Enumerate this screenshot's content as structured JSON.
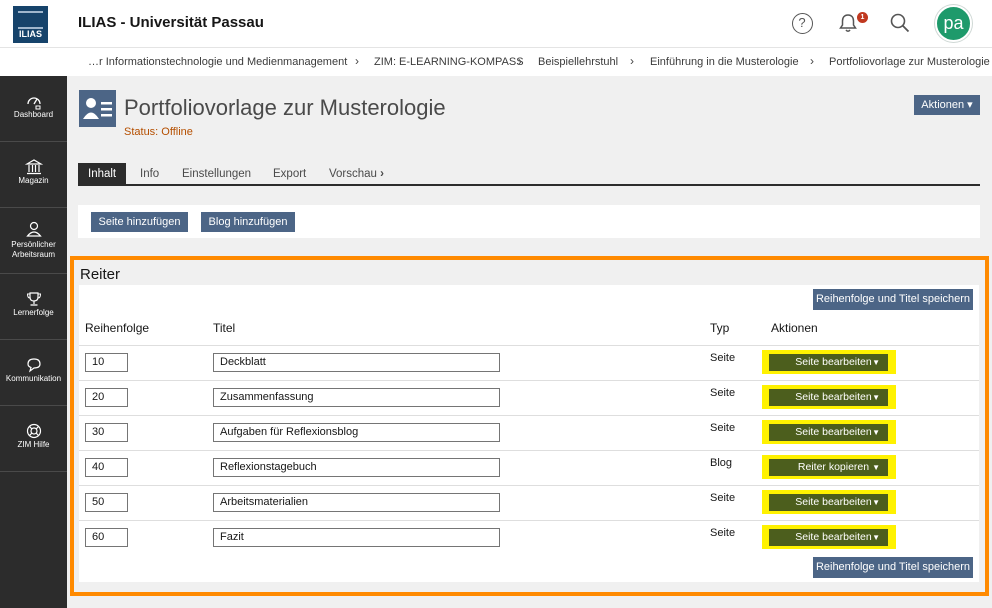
{
  "header": {
    "logo_text": "ILIAS",
    "site_title": "ILIAS - Universität Passau",
    "notification_count": "1",
    "avatar_initials": "pa"
  },
  "breadcrumb": [
    "…r Informationstechnologie und Medienmanagement",
    "ZIM: E-LEARNING-KOMPASS",
    "Beispiellehrstuhl",
    "Einführung in die Musterologie",
    "Portfoliovorlage zur Musterologie"
  ],
  "sidebar": {
    "items": [
      {
        "label": "Dashboard",
        "icon": "dashboard-icon"
      },
      {
        "label": "Magazin",
        "icon": "repository-icon"
      },
      {
        "label": "Persönlicher Arbeitsraum",
        "icon": "personal-workspace-icon"
      },
      {
        "label": "Lernerfolge",
        "icon": "trophy-icon"
      },
      {
        "label": "Kommunikation",
        "icon": "chat-icon"
      },
      {
        "label": "ZIM Hilfe",
        "icon": "lifebuoy-icon"
      }
    ]
  },
  "page": {
    "title": "Portfoliovorlage zur Musterologie",
    "status": "Status: Offline",
    "actions_label": "Aktionen"
  },
  "tabs": [
    {
      "label": "Inhalt",
      "active": true
    },
    {
      "label": "Info",
      "active": false
    },
    {
      "label": "Einstellungen",
      "active": false
    },
    {
      "label": "Export",
      "active": false
    },
    {
      "label": "Vorschau",
      "active": false
    }
  ],
  "toolbar": {
    "add_page": "Seite hinzufügen",
    "add_blog": "Blog hinzufügen"
  },
  "panel": {
    "title": "Reiter",
    "save_label": "Reihenfolge und Titel speichern",
    "columns": [
      "Reihenfolge",
      "Titel",
      "Typ",
      "Aktionen"
    ],
    "rows": [
      {
        "order": "10",
        "title": "Deckblatt",
        "type": "Seite",
        "action": "Seite bearbeiten"
      },
      {
        "order": "20",
        "title": "Zusammenfassung",
        "type": "Seite",
        "action": "Seite bearbeiten"
      },
      {
        "order": "30",
        "title": "Aufgaben für Reflexionsblog",
        "type": "Seite",
        "action": "Seite bearbeiten"
      },
      {
        "order": "40",
        "title": "Reflexionstagebuch",
        "type": "Blog",
        "action": "Reiter kopieren"
      },
      {
        "order": "50",
        "title": "Arbeitsmaterialien",
        "type": "Seite",
        "action": "Seite bearbeiten"
      },
      {
        "order": "60",
        "title": "Fazit",
        "type": "Seite",
        "action": "Seite bearbeiten"
      }
    ]
  },
  "colors": {
    "primary_button": "#4c6586",
    "action_button": "#4c5e1d",
    "highlight_frame": "#ff8a00",
    "highlight_button": "#fff200",
    "sidebar": "#2c2c2c",
    "status_offline": "#b54f00"
  }
}
